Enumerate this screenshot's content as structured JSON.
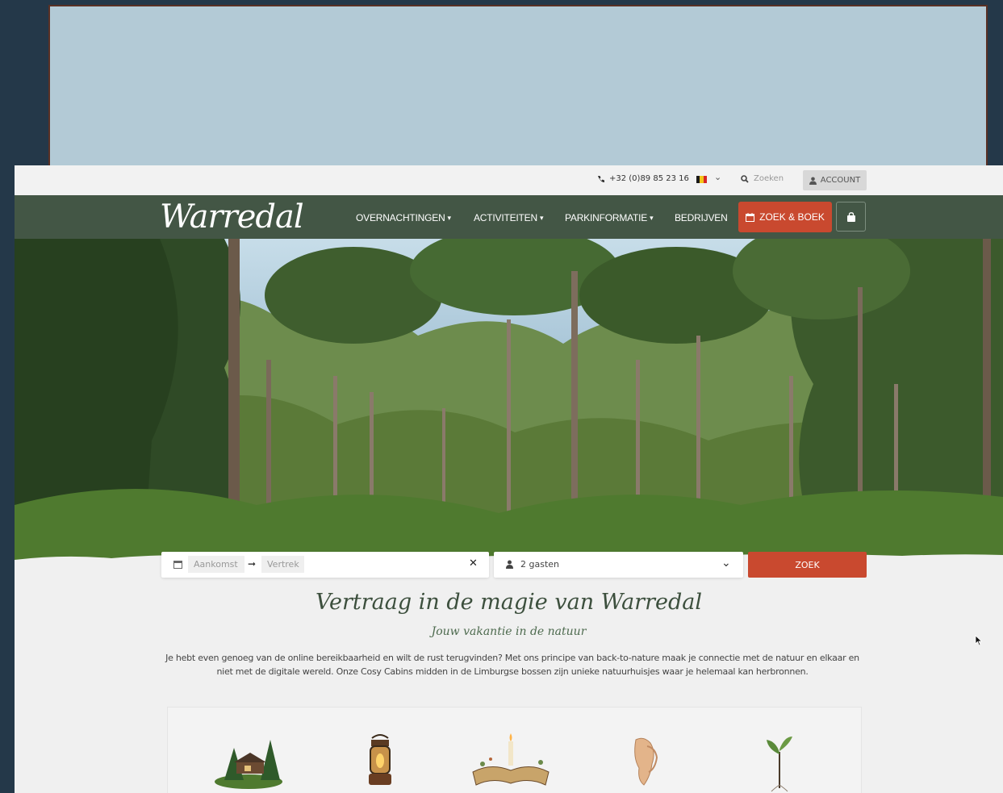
{
  "topbar": {
    "phone": "+32 (0)89 85 23 16",
    "search_placeholder": "Zoeken",
    "account_label": "ACCOUNT",
    "flag_colors": [
      "#1a1a1a",
      "#f2c518",
      "#d62828"
    ]
  },
  "nav": {
    "logo": "Warredal",
    "items": [
      {
        "label": "OVERNACHTINGEN",
        "has_dropdown": true
      },
      {
        "label": "ACTIVITEITEN",
        "has_dropdown": true
      },
      {
        "label": "PARKINFORMATIE",
        "has_dropdown": true
      },
      {
        "label": "BEDRIJVEN",
        "has_dropdown": false
      }
    ],
    "book_label": "ZOEK & BOEK",
    "cart_icon": "shopping-bag-icon"
  },
  "booking": {
    "arrival_placeholder": "Aankomst",
    "departure_placeholder": "Vertrek",
    "guests_value": "2 gasten",
    "search_label": "ZOEK"
  },
  "content": {
    "headline": "Vertraag in de magie van Warredal",
    "subline": "Jouw vakantie in de natuur",
    "intro": "Je hebt even genoeg van de online bereikbaarheid en wilt de rust terugvinden? Met ons principe van back-to-nature maak je connectie met de natuur en elkaar en niet met de digitale wereld. Onze Cosy Cabins midden in de Limburgse bossen zijn unieke natuurhuisjes waar je helemaal kan herbronnen."
  },
  "features": {
    "icons": [
      "cabin-in-forest-icon",
      "lantern-icon",
      "open-book-candle-icon",
      "holding-hands-icon",
      "sprout-icon"
    ]
  },
  "colors": {
    "nav_green": "#435645",
    "accent_red": "#c9492f",
    "headline_green": "#3c4f3d"
  }
}
